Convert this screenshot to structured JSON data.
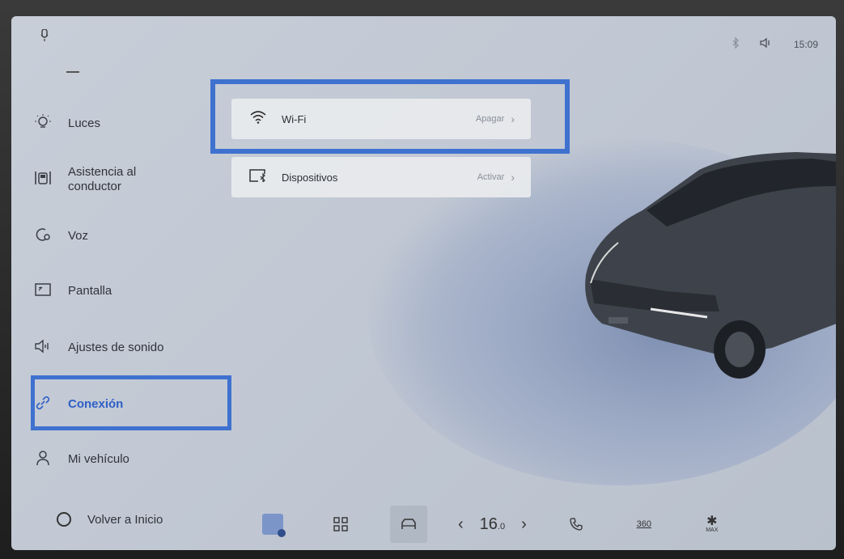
{
  "status": {
    "time": "15:09",
    "icons": [
      "microphone-icon",
      "bluetooth-icon",
      "volume-icon"
    ]
  },
  "sidebar": {
    "items": [
      {
        "label": "Luces",
        "icon": "light-bulb-icon"
      },
      {
        "label": "Asistencia al conductor",
        "icon": "driver-assist-icon"
      },
      {
        "label": "Voz",
        "icon": "voice-icon"
      },
      {
        "label": "Pantalla",
        "icon": "display-icon"
      },
      {
        "label": "Ajustes de sonido",
        "icon": "sound-icon"
      },
      {
        "label": "Conexión",
        "icon": "link-icon",
        "active": true
      },
      {
        "label": "Mi vehículo",
        "icon": "person-icon"
      }
    ],
    "home_label": "Volver a Inicio"
  },
  "cards": [
    {
      "title": "Wi-Fi",
      "state": "Apagar",
      "icon": "wifi-icon"
    },
    {
      "title": "Dispositivos",
      "state": "Activar",
      "icon": "bluetooth-devices-icon"
    }
  ],
  "dock": {
    "temperature": "16",
    "temperature_decimal": ".0",
    "icons": [
      "music-app-icon",
      "apps-grid-icon",
      "car-icon",
      "temp-down-icon",
      "temp-up-icon",
      "phone-icon",
      "camera-360-icon",
      "defrost-max-icon"
    ],
    "label_360": "360",
    "label_max": "MAX"
  },
  "colors": {
    "accent": "#3f71cf",
    "active_text": "#2e5fc7"
  }
}
